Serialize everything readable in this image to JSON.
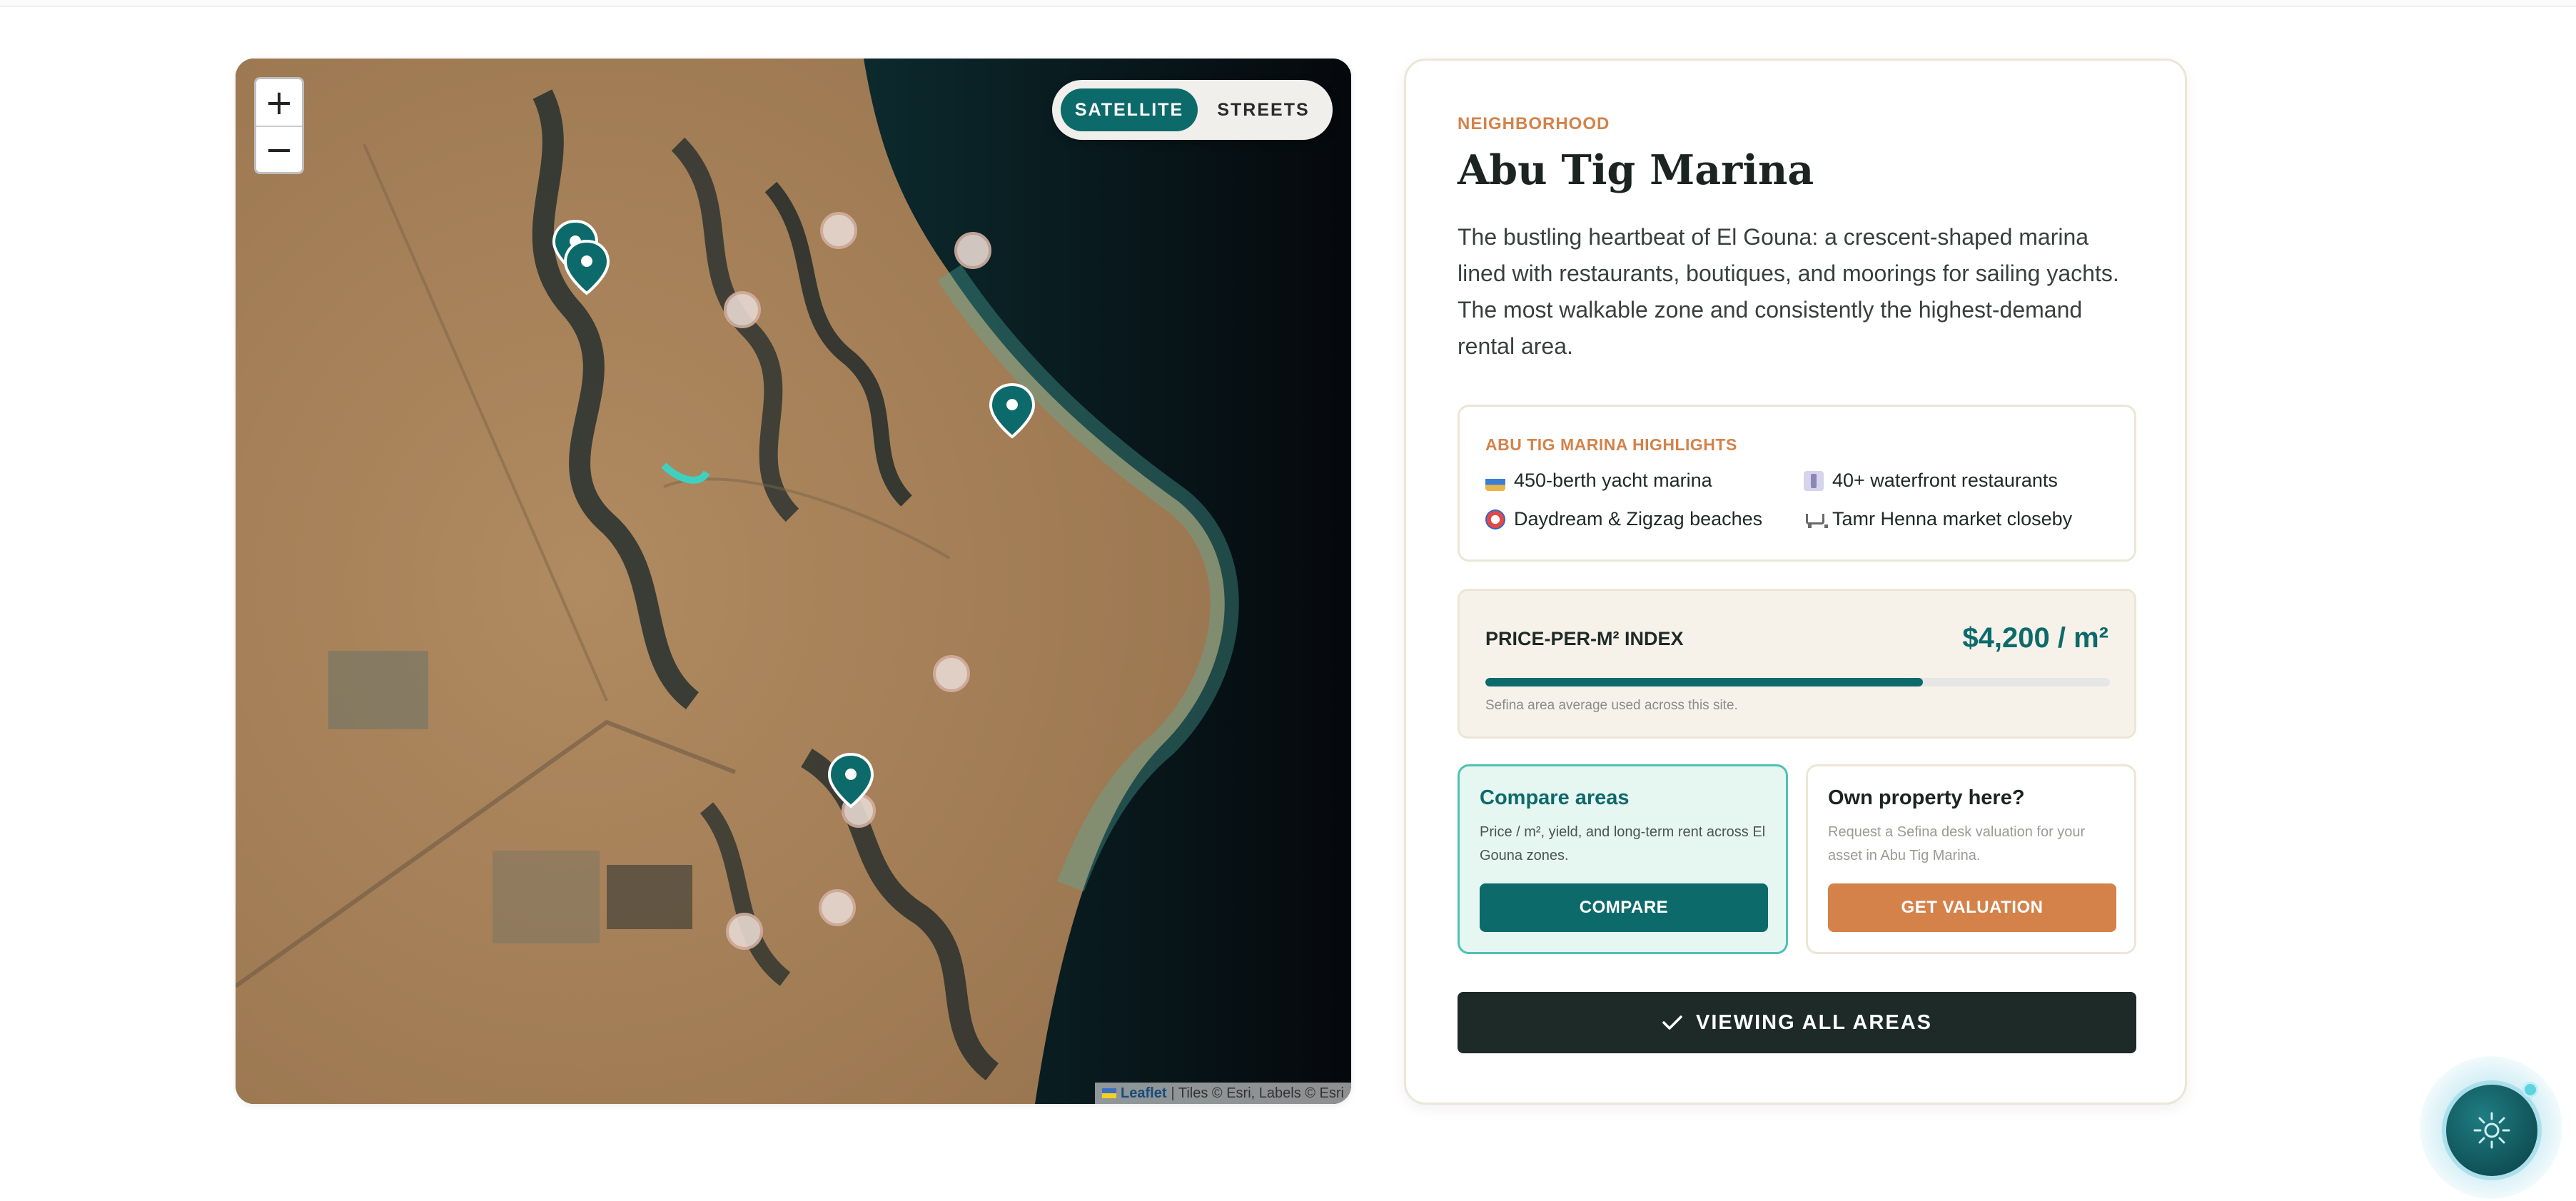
{
  "map": {
    "zoom_in": "+",
    "zoom_out": "−",
    "layers": {
      "satellite": "SATELLITE",
      "streets": "STREETS",
      "active": "satellite"
    },
    "attribution": {
      "leaflet": "Leaflet",
      "tiles": "| Tiles © Esri, Labels © Esri"
    }
  },
  "panel": {
    "kicker": "NEIGHBORHOOD",
    "title": "Abu Tig Marina",
    "description": "The bustling heartbeat of El Gouna: a crescent-shaped marina lined with restaurants, boutiques, and moorings for sailing yachts. The most walkable zone and consistently the highest-demand rental area.",
    "highlights": {
      "title": "ABU TIG MARINA HIGHLIGHTS",
      "items": [
        {
          "icon": "yacht-icon",
          "label": "450-berth yacht marina"
        },
        {
          "icon": "fork-knife-icon",
          "label": "40+ waterfront restaurants"
        },
        {
          "icon": "beach-ring-icon",
          "label": "Daydream & Zigzag beaches"
        },
        {
          "icon": "shopping-cart-icon",
          "label": "Tamr Henna market closeby"
        }
      ]
    },
    "price": {
      "label": "PRICE-PER-M² INDEX",
      "value": "$4,200 / m²",
      "bar_fraction": 0.7,
      "note": "Sefina area average used across this site."
    },
    "compare": {
      "title": "Compare areas",
      "text": "Price / m², yield, and long-term rent across El Gouna zones.",
      "button": "COMPARE"
    },
    "own": {
      "title": "Own property here?",
      "text": "Request a Sefina desk valuation for your asset in Abu Tig Marina.",
      "button": "GET VALUATION"
    },
    "view_all": "VIEWING ALL AREAS"
  },
  "colors": {
    "teal": "#0d6a6b",
    "accent": "#d4824a",
    "dark": "#1d2a27"
  }
}
